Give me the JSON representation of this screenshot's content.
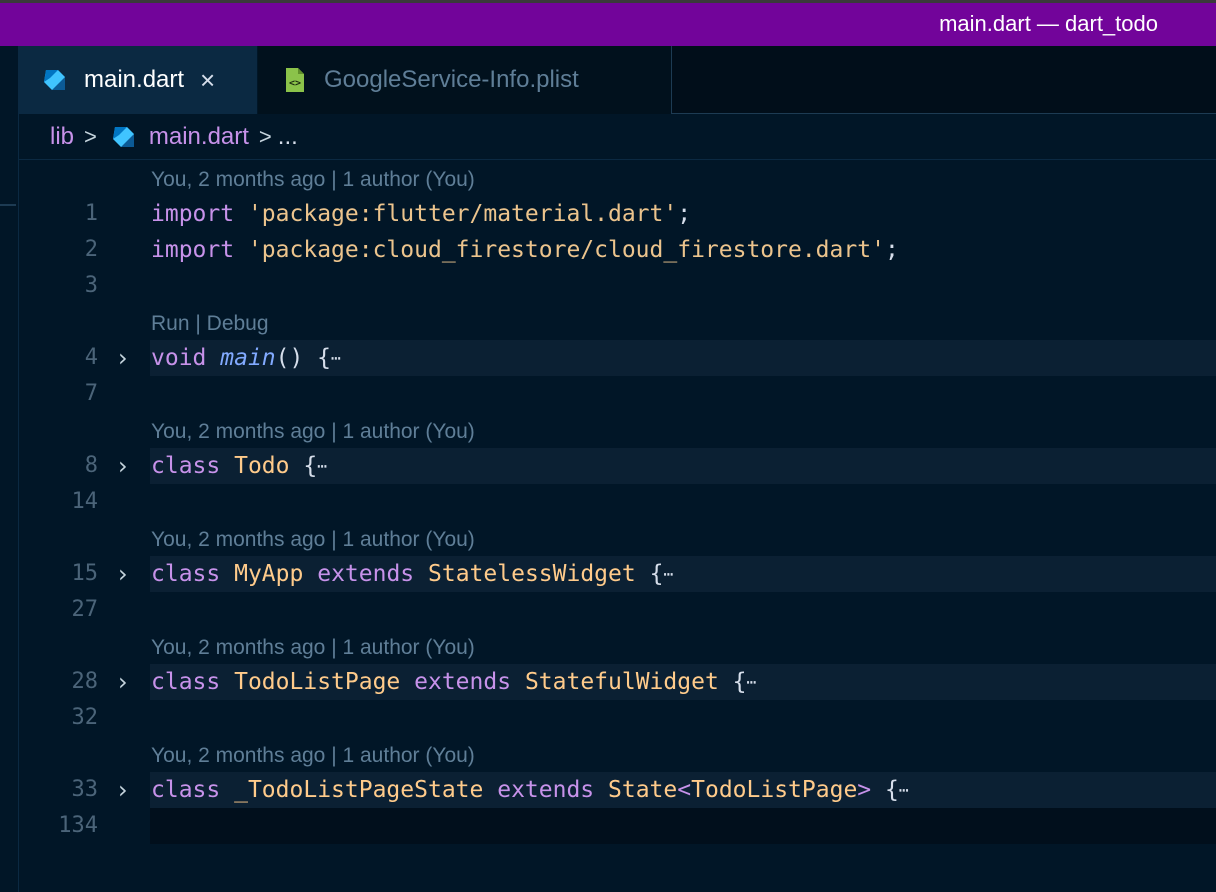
{
  "window": {
    "title": "main.dart — dart_todo"
  },
  "tabs": [
    {
      "label": "main.dart",
      "close": "×",
      "icon": "dart-icon"
    },
    {
      "label": "GoogleService-Info.plist",
      "icon": "plist-file-icon"
    }
  ],
  "breadcrumb": {
    "folder": "lib",
    "sep": ">",
    "file": "main.dart",
    "more": "..."
  },
  "blame": "You, 2 months ago | 1 author (You)",
  "runlens": "Run | Debug",
  "lines": {
    "l1": {
      "num": "1",
      "kw": "import",
      "str": "'package:flutter/material.dart'",
      "end": ";"
    },
    "l2": {
      "num": "2",
      "kw": "import",
      "str": "'package:cloud_firestore/cloud_firestore.dart'",
      "end": ";"
    },
    "l3": {
      "num": "3"
    },
    "l4": {
      "num": "4",
      "kw": "void",
      "fn": "main",
      "rest": "() {"
    },
    "l7": {
      "num": "7"
    },
    "l8": {
      "num": "8",
      "kw": "class",
      "cls": "Todo",
      "rest": "{"
    },
    "l14": {
      "num": "14"
    },
    "l15": {
      "num": "15",
      "kw": "class",
      "cls": "MyApp",
      "kw2": "extends",
      "cls2": "StatelessWidget",
      "rest": "{"
    },
    "l27": {
      "num": "27"
    },
    "l28": {
      "num": "28",
      "kw": "class",
      "cls": "TodoListPage",
      "kw2": "extends",
      "cls2": "StatefulWidget",
      "rest": "{"
    },
    "l32": {
      "num": "32"
    },
    "l33": {
      "num": "33",
      "kw": "class",
      "cls": "_TodoListPageState",
      "kw2": "extends",
      "cls2": "State",
      "gen_open": "<",
      "cls3": "TodoListPage",
      "gen_close": ">",
      "rest": "{"
    },
    "l134": {
      "num": "134"
    }
  },
  "fold_ellipsis": "⋯",
  "colors": {
    "titlebar": "#72049a",
    "background": "#011627",
    "keyword": "#c792ea",
    "string": "#ecc48d",
    "class": "#ffcb8b",
    "function": "#82aaff"
  }
}
